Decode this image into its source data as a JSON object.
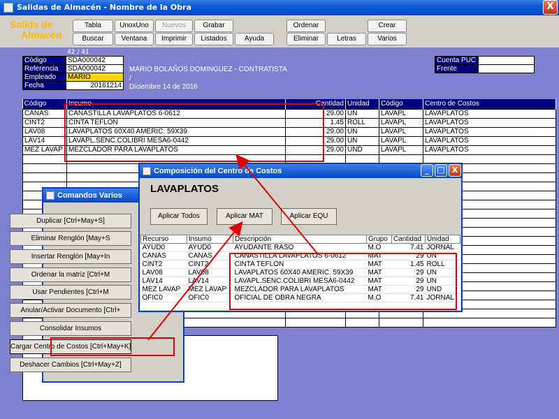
{
  "window": {
    "title": "Salidas de Almacén - Nombre de la Obra",
    "close_label": "X"
  },
  "brand": {
    "line1": "Salida de",
    "line2": "Almacén"
  },
  "toolbar": {
    "row1": [
      "Tabla",
      "UnoxUno",
      "Nuevos",
      "Grabar"
    ],
    "row2": [
      "Buscar",
      "Ventana",
      "Imprimir",
      "Listados",
      "Ayuda"
    ],
    "right_row1": [
      "Ordenar",
      "Crear"
    ],
    "right_row2": [
      "Eliminar",
      "Letras",
      "Varios"
    ]
  },
  "counter": "42 / 41",
  "header": {
    "codigo_label": "Código",
    "codigo_value": "SDA000042",
    "referencia_label": "Referencia",
    "referencia_value": "SDA000042",
    "empleado_label": "Empleado",
    "empleado_value": "MARIO",
    "fecha_label": "Fecha",
    "fecha_value": "20161214",
    "contratista": "MARIO BOLAÑOS DOMINGUEZ - CONTRATISTA",
    "slash": "/",
    "fecha_texto": "Diciembre 14 de 2016",
    "cuenta_label": "Cuenta PUC",
    "frente_label": "Frente"
  },
  "grid": {
    "columns": [
      "Código",
      "Insumo",
      "Cantidad",
      "Unidad",
      "Código",
      "Centro de Costos"
    ],
    "rows": [
      [
        "CANAS",
        "CANASTILLA LAVAPLATOS   6-0612",
        "29.00",
        "UN",
        "LAVAPL",
        "LAVAPLATOS"
      ],
      [
        "CINT2",
        "CINTA TEFLON",
        "1.45",
        "ROLL",
        "LAVAPL",
        "LAVAPLATOS"
      ],
      [
        "LAV08",
        "LAVAPLATOS 60X40 AMERIC. 59X39",
        "29.00",
        "UN",
        "LAVAPL",
        "LAVAPLATOS"
      ],
      [
        "LAV14",
        "LAVAPL.SENC.COLIBRI MESA6-0442",
        "29.00",
        "UN",
        "LAVAPL",
        "LAVAPLATOS"
      ],
      [
        "MEZ LAVAP",
        "MEZCLADOR PARA LAVAPLATOS",
        "29.00",
        "UND",
        "LAVAPL",
        "LAVAPLATOS"
      ]
    ]
  },
  "comandos": {
    "title": "Comandos Varios",
    "buttons": [
      "Duplicar [Ctrl+May+S]",
      "Eliminar Renglón [May+S",
      "Insertar Renglón [May+In",
      "Ordenar la matriz [Ctrl+M",
      "Usar Pendientes [Ctrl+M",
      "Anular/Activar Documento [Ctrl+",
      "Consolidar Insumos",
      "Cargar Centro de Costos [Ctrl+May+K]",
      "Deshacer Cambios [Ctrl+May+Z]"
    ]
  },
  "composicion": {
    "title": "Composición del Centro de Costos",
    "heading": "LAVAPLATOS",
    "buttons": [
      "Aplicar Todos",
      "Aplicar MAT",
      "Aplicar EQU"
    ],
    "columns": [
      "Recurso",
      "Insumo",
      "Descripción",
      "Grupo",
      "Cantidad",
      "Unidad"
    ],
    "rows": [
      [
        "AYUD0",
        "AYUD0",
        "AYUDANTE RASO",
        "M.O",
        "7.41",
        "JORNAL"
      ],
      [
        "CANAS",
        "CANAS",
        "CANASTILLA LAVAPLATOS   6-0612",
        "MAT",
        "29",
        "UN"
      ],
      [
        "CINT2",
        "CINT2",
        "CINTA TEFLON",
        "MAT",
        "1.45",
        "ROLL"
      ],
      [
        "LAV08",
        "LAV08",
        "LAVAPLATOS 60X40 AMERIC. 59X39",
        "MAT",
        "29",
        "UN"
      ],
      [
        "LAV14",
        "LAV14",
        "LAVAPL.SENC.COLIBRI MESA6-0442",
        "MAT",
        "29",
        "UN"
      ],
      [
        "MEZ LAVAP",
        "MEZ LAVAP",
        "MEZCLADOR PARA LAVAPLATOS",
        "MAT",
        "29",
        "UND"
      ],
      [
        "OFIC0",
        "OFIC0",
        "OFICIAL DE OBRA NEGRA",
        "M.O",
        "7.41",
        "JORNAL"
      ]
    ]
  },
  "colors": {
    "accent": "#000080",
    "brand": "#ffb800",
    "highlight": "#e00000"
  }
}
